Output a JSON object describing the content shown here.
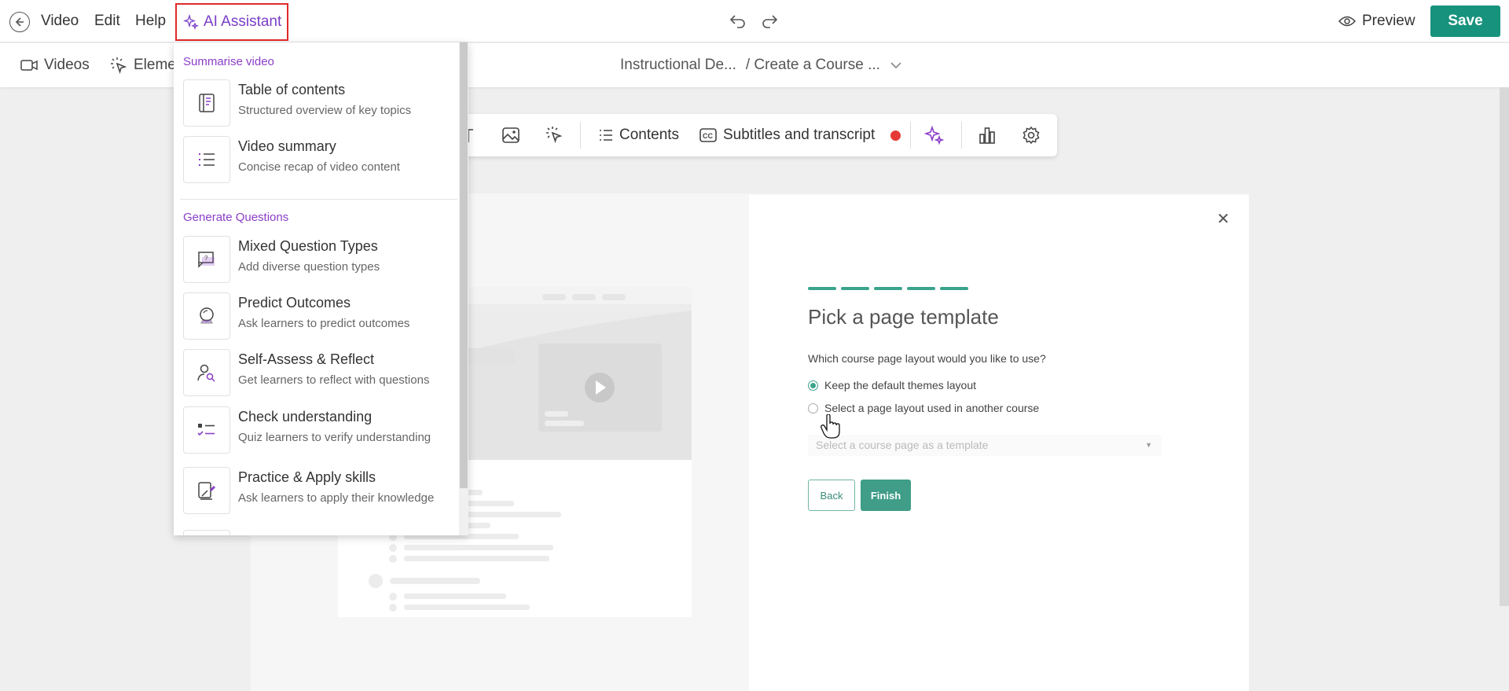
{
  "topbar": {
    "menu": [
      "Video",
      "Edit",
      "Help"
    ],
    "ai_assistant": "AI Assistant",
    "preview": "Preview",
    "save": "Save"
  },
  "subbar": {
    "tabs": [
      "Videos",
      "Elemen"
    ],
    "breadcrumb": [
      "Instructional De...",
      "/ Create a Course ..."
    ]
  },
  "toolbar": {
    "contents": "Contents",
    "subtitles": "Subtitles and transcript",
    "recording_dot_color": "#e53935"
  },
  "dialog": {
    "title": "Pick a page template",
    "question": "Which course page layout would you like to use?",
    "option_default": "Keep the default themes layout",
    "option_other": "Select a page layout used in another course",
    "select_placeholder": "Select a course page as a template",
    "back": "Back",
    "finish": "Finish",
    "progress_steps": 5
  },
  "dropdown": {
    "section_summarise": "Summarise video",
    "section_generate": "Generate Questions",
    "items": [
      {
        "title": "Table of contents",
        "desc": "Structured overview of key topics",
        "icon": "book-icon"
      },
      {
        "title": "Video summary",
        "desc": "Concise recap of video content",
        "icon": "list-icon"
      },
      {
        "title": "Mixed Question Types",
        "desc": "Add diverse question types",
        "icon": "question-chat-icon"
      },
      {
        "title": "Predict Outcomes",
        "desc": "Ask learners to predict outcomes",
        "icon": "crystal-ball-icon"
      },
      {
        "title": "Self-Assess & Reflect",
        "desc": "Get learners to reflect with questions",
        "icon": "person-search-icon"
      },
      {
        "title": "Check understanding",
        "desc": "Quiz learners to verify understanding",
        "icon": "checklist-icon"
      },
      {
        "title": "Practice & Apply skills",
        "desc": "Ask learners to apply their knowledge",
        "icon": "pencil-board-icon"
      }
    ]
  },
  "colors": {
    "accent": "#17927d",
    "ai_purple": "#7a3ec8",
    "highlight_border": "#e02a2a"
  }
}
